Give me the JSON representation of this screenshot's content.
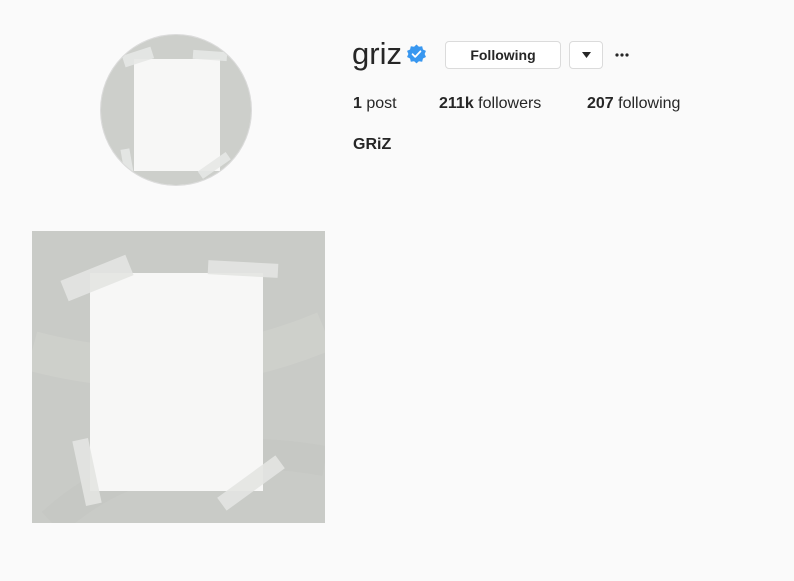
{
  "profile": {
    "username": "griz",
    "verified": true,
    "follow_button_label": "Following",
    "full_name": "GRiZ",
    "stats": {
      "posts_count": "1",
      "posts_label": "post",
      "followers_count": "211k",
      "followers_label": "followers",
      "following_count": "207",
      "following_label": "following"
    }
  },
  "icons": {
    "verified": "verified-badge-icon",
    "dropdown": "caret-down-icon",
    "more": "more-options-icon"
  },
  "colors": {
    "background": "#fafafa",
    "verified_blue": "#3897f0",
    "text": "#262626",
    "border": "#dbdbdb"
  },
  "posts": [
    {
      "alt": ""
    }
  ]
}
